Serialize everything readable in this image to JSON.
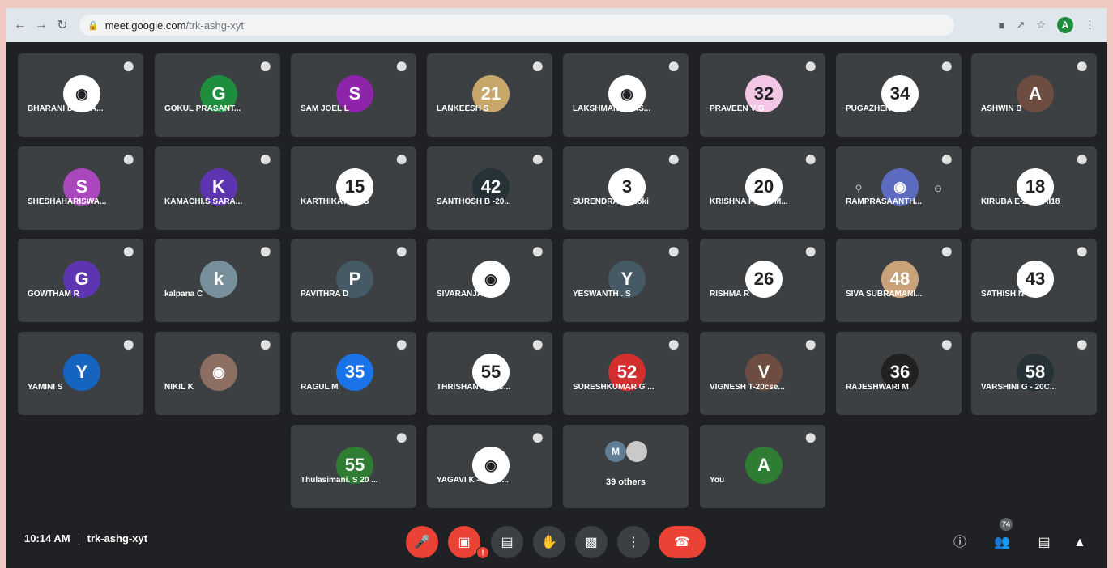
{
  "browser": {
    "url_host": "meet.google.com",
    "url_path": "/trk-ashg-xyt",
    "profile_initial": "A"
  },
  "colors": {
    "meet_bg": "#202124",
    "tile_bg": "#3c4043",
    "danger": "#ea4335"
  },
  "participants": [
    {
      "name": "BHARANI DHARA...",
      "avatar_text": "",
      "avatar_color": "#ffffff",
      "avatar_icon": "character-photo"
    },
    {
      "name": "GOKUL PRASANT...",
      "avatar_text": "G",
      "avatar_color": "#1e8e3e"
    },
    {
      "name": "SAM JOEL L",
      "avatar_text": "S",
      "avatar_color": "#8e24aa"
    },
    {
      "name": "LANKEESH S",
      "avatar_text": "21",
      "avatar_color": "#c8a86a"
    },
    {
      "name": "LAKSHMAN PRAS...",
      "avatar_text": "",
      "avatar_color": "#ffffff",
      "avatar_icon": "logo-photo"
    },
    {
      "name": "PRAVEEN V G",
      "avatar_text": "32",
      "avatar_color": "#f3c6e6"
    },
    {
      "name": "PUGAZHENDHI V",
      "avatar_text": "34",
      "avatar_color": "#ffffff"
    },
    {
      "name": "ASHWIN B",
      "avatar_text": "A",
      "avatar_color": "#6d4c41"
    },
    {
      "name": "SHESHAHARISWA...",
      "avatar_text": "S",
      "avatar_color": "#ab47bc"
    },
    {
      "name": "KAMACHI.S SARA...",
      "avatar_text": "K",
      "avatar_color": "#5e35b1"
    },
    {
      "name": "KARTHIKAYANI G",
      "avatar_text": "15",
      "avatar_color": "#ffffff"
    },
    {
      "name": "SANTHOSH B -20...",
      "avatar_text": "42",
      "avatar_color": "#263238"
    },
    {
      "name": "SURENDRAN #Roki",
      "avatar_text": "3",
      "avatar_color": "#ffffff"
    },
    {
      "name": "KRISHNA PRIYA M...",
      "avatar_text": "20",
      "avatar_color": "#ffffff"
    },
    {
      "name": "RAMPRASAANTH...",
      "avatar_text": "",
      "avatar_color": "#5c6bc0",
      "avatar_icon": "photo",
      "has_side_buttons": true
    },
    {
      "name": "KIRUBA E-20CSAI18",
      "avatar_text": "18",
      "avatar_color": "#ffffff"
    },
    {
      "name": "GOWTHAM R",
      "avatar_text": "G",
      "avatar_color": "#5e35b1"
    },
    {
      "name": "kalpana C",
      "avatar_text": "k",
      "avatar_color": "#78909c"
    },
    {
      "name": "PAVITHRA D",
      "avatar_text": "P",
      "avatar_color": "#455a64"
    },
    {
      "name": "SIVARANJANI T",
      "avatar_text": "",
      "avatar_color": "#ffffff",
      "avatar_icon": "feather-photo"
    },
    {
      "name": "YESWANTH . S",
      "avatar_text": "Y",
      "avatar_color": "#455a64"
    },
    {
      "name": "RISHMA R",
      "avatar_text": "26",
      "avatar_color": "#ffffff"
    },
    {
      "name": "SIVA SUBRAMANI...",
      "avatar_text": "48",
      "avatar_color": "#c9a27a"
    },
    {
      "name": "SATHISH N",
      "avatar_text": "43",
      "avatar_color": "#ffffff"
    },
    {
      "name": "YAMINI S",
      "avatar_text": "Y",
      "avatar_color": "#1565c0"
    },
    {
      "name": "NIKIL K",
      "avatar_text": "",
      "avatar_color": "#8d6e63",
      "avatar_icon": "person-photo"
    },
    {
      "name": "RAGUL M",
      "avatar_text": "35",
      "avatar_color": "#1a73e8"
    },
    {
      "name": "THRISHAN A-20C...",
      "avatar_text": "55",
      "avatar_color": "#ffffff"
    },
    {
      "name": "SURESHKUMAR G ...",
      "avatar_text": "52",
      "avatar_color": "#d32f2f"
    },
    {
      "name": "VIGNESH T-20cse...",
      "avatar_text": "V",
      "avatar_color": "#6d4c41"
    },
    {
      "name": "RAJESHWARI M",
      "avatar_text": "36",
      "avatar_color": "#212121"
    },
    {
      "name": "VARSHINI G - 20C...",
      "avatar_text": "58",
      "avatar_color": "#263238"
    },
    {
      "name": "Thulasimani. S 20 ...",
      "avatar_text": "55",
      "avatar_color": "#2e7d32"
    },
    {
      "name": "YAGAVI K - 20CS...",
      "avatar_text": "",
      "avatar_color": "#ffffff",
      "avatar_icon": "feather-photo"
    }
  ],
  "others_tile": {
    "label": "39 others",
    "mini_initial": "M"
  },
  "self_tile": {
    "name": "You",
    "avatar_text": "A",
    "avatar_color": "#2e7d32"
  },
  "meeting": {
    "time": "10:14 AM",
    "code": "trk-ashg-xyt"
  },
  "controls": {
    "mic": "mic-off-icon",
    "camera": "camera-off-icon",
    "captions": "captions-icon",
    "raise_hand": "raise-hand-icon",
    "present": "present-screen-icon",
    "more": "more-vert-icon",
    "end_call": "end-call-icon",
    "camera_warning": "!"
  },
  "right_controls": {
    "info": "info-icon",
    "people": "people-icon",
    "people_count": "74",
    "chat": "chat-icon",
    "activities": "activities-icon"
  }
}
